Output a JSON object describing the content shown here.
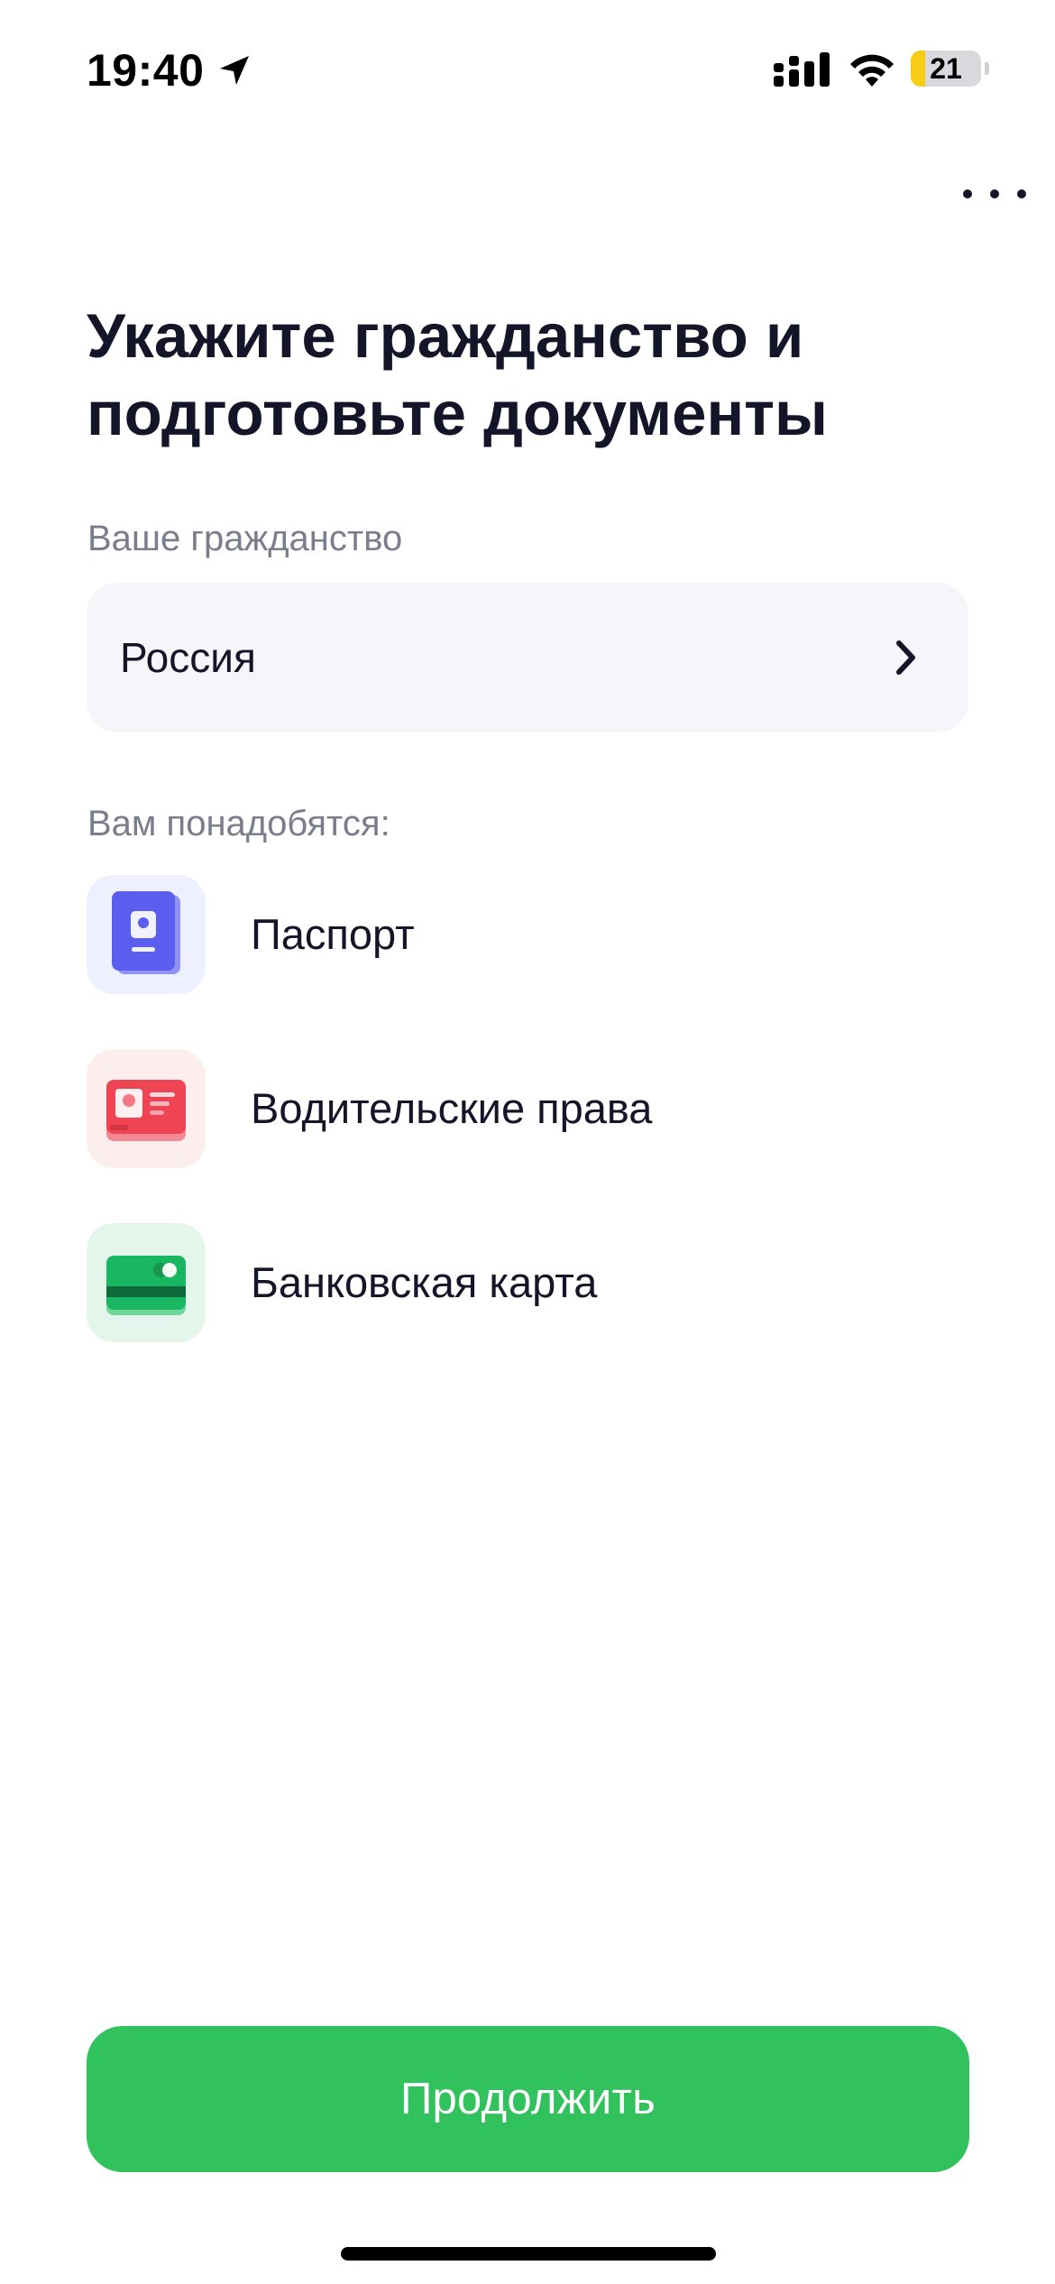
{
  "status_bar": {
    "time": "19:40",
    "battery_level": "21",
    "battery_fraction": 0.21,
    "icons": [
      "location-arrow-icon",
      "signal-icon",
      "wifi-icon",
      "battery-icon"
    ]
  },
  "header": {
    "more_icon": "more-dots-icon"
  },
  "page": {
    "title": "Укажите гражданство и подготовьте документы"
  },
  "citizenship": {
    "label": "Ваше гражданство",
    "value": "Россия",
    "icon": "chevron-right-icon"
  },
  "requirements": {
    "label": "Вам понадобятся:",
    "items": [
      {
        "label": "Паспорт",
        "icon": "passport-icon",
        "tile_color": "#eef0ff",
        "accent": "#5c5ef0"
      },
      {
        "label": "Водительские права",
        "icon": "drivers-license-icon",
        "tile_color": "#fdeeee",
        "accent": "#ee4454"
      },
      {
        "label": "Банковская карта",
        "icon": "bank-card-icon",
        "tile_color": "#e4f6ec",
        "accent": "#1bb662"
      }
    ]
  },
  "actions": {
    "continue_label": "Продолжить",
    "continue_color": "#31c25d"
  }
}
